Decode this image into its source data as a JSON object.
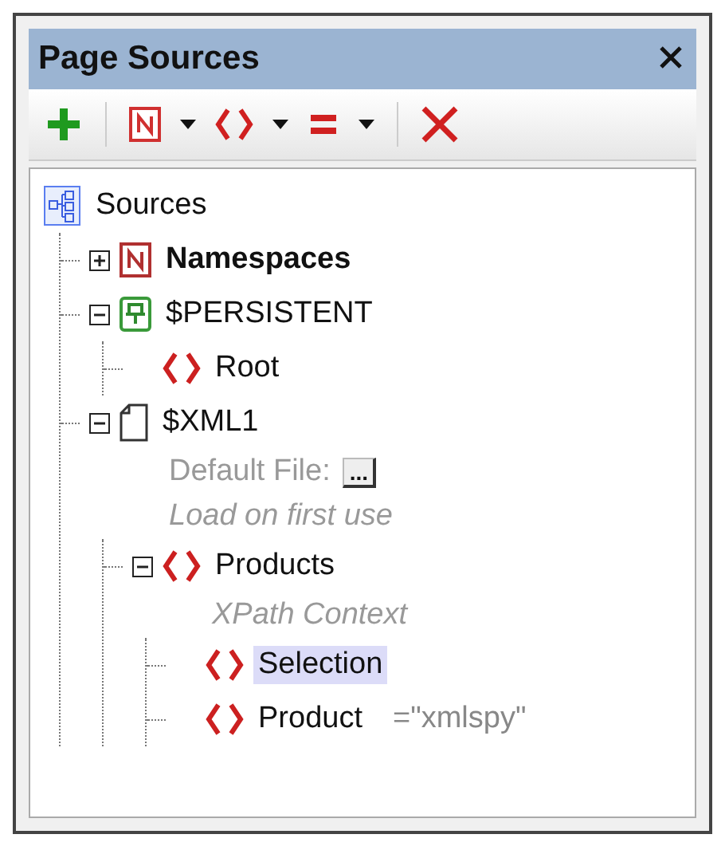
{
  "window": {
    "title": "Page Sources"
  },
  "tree": {
    "label": "Sources",
    "kind": "sources",
    "bold": false,
    "selected": false,
    "children": [
      {
        "label": "Namespaces",
        "kind": "namespace",
        "bold": true,
        "selected": false,
        "expanded": false
      },
      {
        "label": "$PERSISTENT",
        "kind": "persistent",
        "bold": false,
        "selected": false,
        "expanded": true,
        "children": [
          {
            "label": "Root",
            "kind": "element",
            "bold": false,
            "selected": false
          }
        ]
      },
      {
        "label": "$XML1",
        "kind": "file",
        "bold": false,
        "selected": false,
        "expanded": true,
        "details": [
          {
            "kind": "field",
            "label": "Default File:",
            "button": "..."
          },
          {
            "kind": "note",
            "text": "Load on first use"
          }
        ],
        "children": [
          {
            "label": "Products",
            "kind": "element",
            "bold": false,
            "selected": false,
            "expanded": true,
            "details": [
              {
                "kind": "note",
                "text": "XPath Context"
              }
            ],
            "children": [
              {
                "label": "Selection",
                "kind": "element",
                "bold": false,
                "selected": true
              },
              {
                "label": "Product",
                "kind": "element",
                "bold": false,
                "selected": false,
                "value": "=\"xmlspy\""
              }
            ]
          }
        ]
      }
    ]
  }
}
